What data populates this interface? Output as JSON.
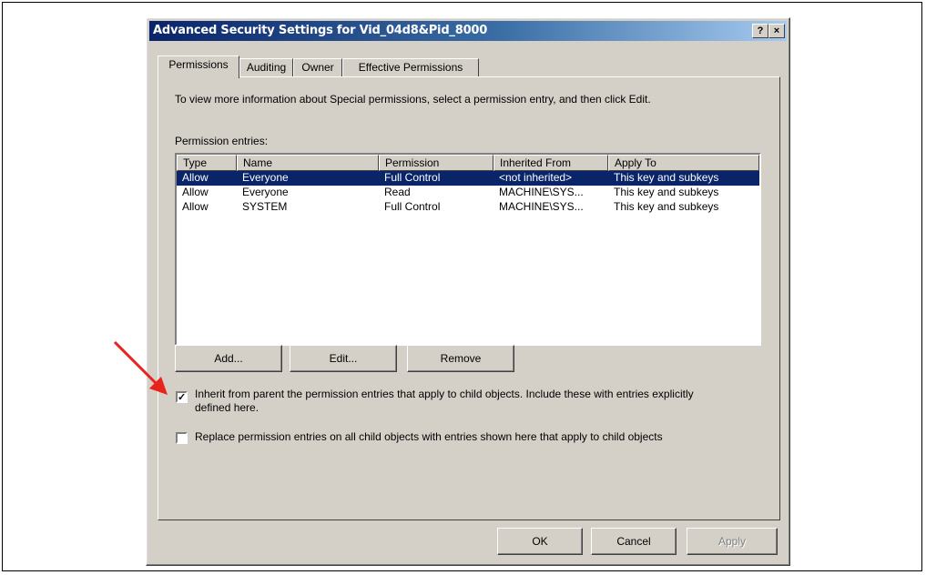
{
  "window": {
    "title": "Advanced Security Settings for Vid_04d8&Pid_8000",
    "help_btn": "?",
    "close_btn": "×"
  },
  "tabs": [
    {
      "label": "Permissions"
    },
    {
      "label": "Auditing"
    },
    {
      "label": "Owner"
    },
    {
      "label": "Effective Permissions"
    }
  ],
  "panel": {
    "info": "To view more information about Special permissions, select a permission entry, and then click Edit.",
    "entries_label": "Permission entries:"
  },
  "table": {
    "columns": [
      "Type",
      "Name",
      "Permission",
      "Inherited From",
      "Apply To"
    ],
    "rows": [
      [
        "Allow",
        "Everyone",
        "Full Control",
        "<not inherited>",
        "This key and subkeys"
      ],
      [
        "Allow",
        "Everyone",
        "Read",
        "MACHINE\\SYS...",
        "This key and subkeys"
      ],
      [
        "Allow",
        "SYSTEM",
        "Full Control",
        "MACHINE\\SYS...",
        "This key and subkeys"
      ]
    ],
    "selected_row": 0
  },
  "buttons": {
    "add": "Add...",
    "edit": "Edit...",
    "remove": "Remove",
    "ok": "OK",
    "cancel": "Cancel",
    "apply": "Apply"
  },
  "checkboxes": {
    "inherit": {
      "checked": true,
      "line1": "Inherit from parent the permission entries that apply to child objects. Include these with entries explicitly",
      "line2": "defined here."
    },
    "replace": {
      "checked": false,
      "label": "Replace permission entries on all child objects with entries shown here that apply to child objects"
    }
  },
  "colors": {
    "title_start": "#0a246a",
    "title_end": "#a6caf0",
    "selection": "#0a246a",
    "annotation_arrow": "#e8231b",
    "dialog_bg": "#d4d0c8"
  }
}
